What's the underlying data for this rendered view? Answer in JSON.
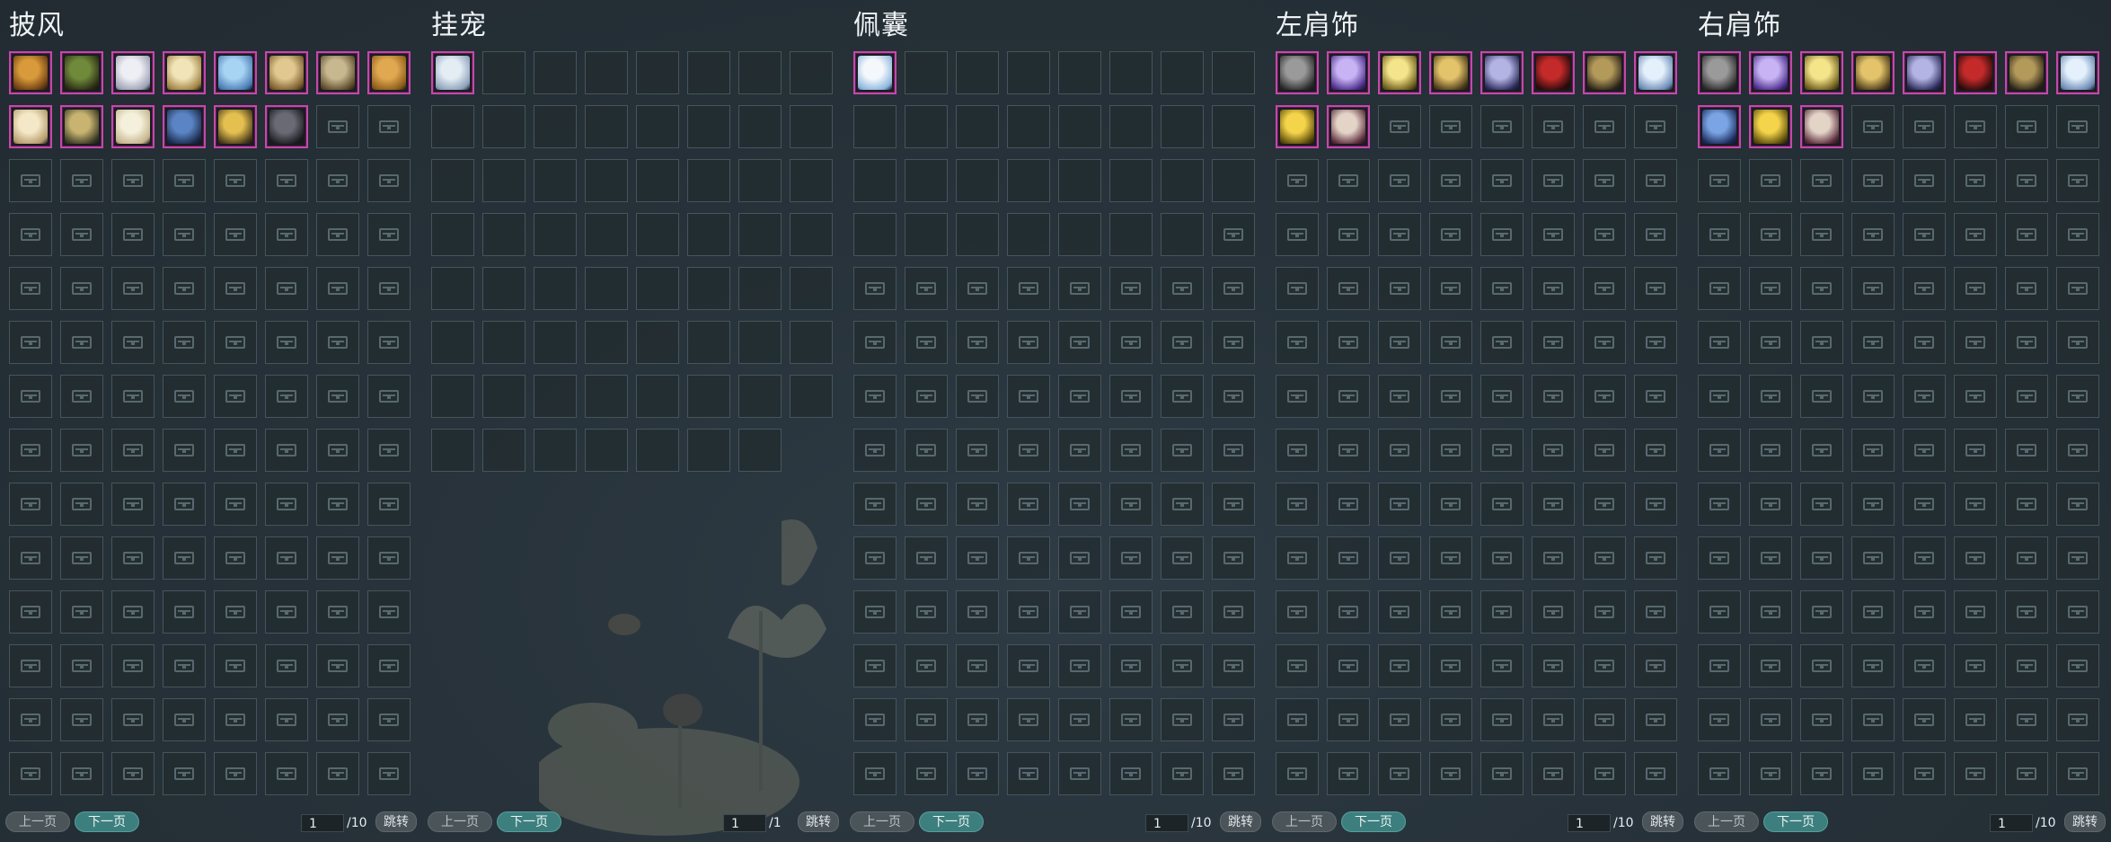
{
  "nav": {
    "prev_label": "上一页",
    "next_label": "下一页",
    "jump_label": "跳转"
  },
  "panels": [
    {
      "id": "cape",
      "title": "披风",
      "page": "1",
      "total": "/10",
      "layout": "full",
      "items": [
        {
          "icon": "cape-icon",
          "c1": "#d89a3a",
          "c2": "#6a3b12"
        },
        {
          "icon": "cape-icon",
          "c1": "#6e8a3a",
          "c2": "#2a2a14"
        },
        {
          "icon": "wing-cape-icon",
          "c1": "#eeeef4",
          "c2": "#9ca0b4"
        },
        {
          "icon": "cape-icon",
          "c1": "#f0e4b8",
          "c2": "#a08040"
        },
        {
          "icon": "cape-icon",
          "c1": "#a8d4f4",
          "c2": "#4a7ab4"
        },
        {
          "icon": "cape-icon",
          "c1": "#e0c890",
          "c2": "#7a5a2a"
        },
        {
          "icon": "cape-icon",
          "c1": "#c8b890",
          "c2": "#5a4a2a"
        },
        {
          "icon": "cape-icon",
          "c1": "#e0a850",
          "c2": "#8a5a1a"
        },
        {
          "icon": "cape-icon",
          "c1": "#f4e8c8",
          "c2": "#b49a6a"
        },
        {
          "icon": "cape-icon",
          "c1": "#c8b470",
          "c2": "#3a3a24"
        },
        {
          "icon": "cape-icon",
          "c1": "#f4f0dc",
          "c2": "#c4b48a"
        },
        {
          "icon": "cape-icon",
          "c1": "#5a84c4",
          "c2": "#1a2a4a"
        },
        {
          "icon": "cape-icon",
          "c1": "#e4c050",
          "c2": "#4a3a1a"
        },
        {
          "icon": "cape-icon",
          "c1": "#6a6a74",
          "c2": "#1a1a20"
        }
      ]
    },
    {
      "id": "pet",
      "title": "挂宠",
      "page": "1",
      "total": "/1",
      "layout": "pet",
      "items": [
        {
          "icon": "eagle-pet-icon",
          "c1": "#e4ecf4",
          "c2": "#8aa0b8"
        }
      ]
    },
    {
      "id": "pouch",
      "title": "佩囊",
      "page": "1",
      "total": "/10",
      "layout": "pouch",
      "items": [
        {
          "icon": "pouch-icon",
          "c1": "#f4f8fc",
          "c2": "#8ab4dc"
        }
      ]
    },
    {
      "id": "left-shoulder",
      "title": "左肩饰",
      "page": "1",
      "total": "/10",
      "layout": "full",
      "items": [
        {
          "icon": "shoulder-icon",
          "c1": "#9a9a9a",
          "c2": "#2a2a2a"
        },
        {
          "icon": "shoulder-icon",
          "c1": "#c8b4f4",
          "c2": "#4a2a8a"
        },
        {
          "icon": "shoulder-icon",
          "c1": "#f4e48a",
          "c2": "#6a5a1a"
        },
        {
          "icon": "shoulder-icon",
          "c1": "#e4c46a",
          "c2": "#4a3a1a"
        },
        {
          "icon": "shoulder-icon",
          "c1": "#b4b4e4",
          "c2": "#2a2a5a"
        },
        {
          "icon": "shoulder-icon",
          "c1": "#c42a2a",
          "c2": "#2a0a0a"
        },
        {
          "icon": "shoulder-icon",
          "c1": "#b49a5a",
          "c2": "#2a2418"
        },
        {
          "icon": "shoulder-icon",
          "c1": "#e4f0fc",
          "c2": "#6a8ab4"
        },
        {
          "icon": "shoulder-icon",
          "c1": "#f4d44a",
          "c2": "#5a4a0a"
        },
        {
          "icon": "shoulder-icon",
          "c1": "#e4d4c8",
          "c2": "#5a2a3a"
        }
      ]
    },
    {
      "id": "right-shoulder",
      "title": "右肩饰",
      "page": "1",
      "total": "/10",
      "layout": "full",
      "items": [
        {
          "icon": "shoulder-icon",
          "c1": "#9a9a9a",
          "c2": "#2a2a2a"
        },
        {
          "icon": "shoulder-icon",
          "c1": "#c8b4f4",
          "c2": "#4a2a8a"
        },
        {
          "icon": "shoulder-icon",
          "c1": "#f4e48a",
          "c2": "#6a5a1a"
        },
        {
          "icon": "shoulder-icon",
          "c1": "#e4c46a",
          "c2": "#4a3a1a"
        },
        {
          "icon": "shoulder-icon",
          "c1": "#b4b4e4",
          "c2": "#2a2a5a"
        },
        {
          "icon": "shoulder-icon",
          "c1": "#c42a2a",
          "c2": "#2a0a0a"
        },
        {
          "icon": "shoulder-icon",
          "c1": "#b49a5a",
          "c2": "#2a2418"
        },
        {
          "icon": "shoulder-icon",
          "c1": "#e4f0fc",
          "c2": "#6a8ab4"
        },
        {
          "icon": "shoulder-icon",
          "c1": "#7aa4e4",
          "c2": "#1a2a5a"
        },
        {
          "icon": "shoulder-icon",
          "c1": "#f4d44a",
          "c2": "#5a4a0a"
        },
        {
          "icon": "shoulder-icon",
          "c1": "#e4d4c8",
          "c2": "#5a2a3a"
        }
      ]
    }
  ]
}
